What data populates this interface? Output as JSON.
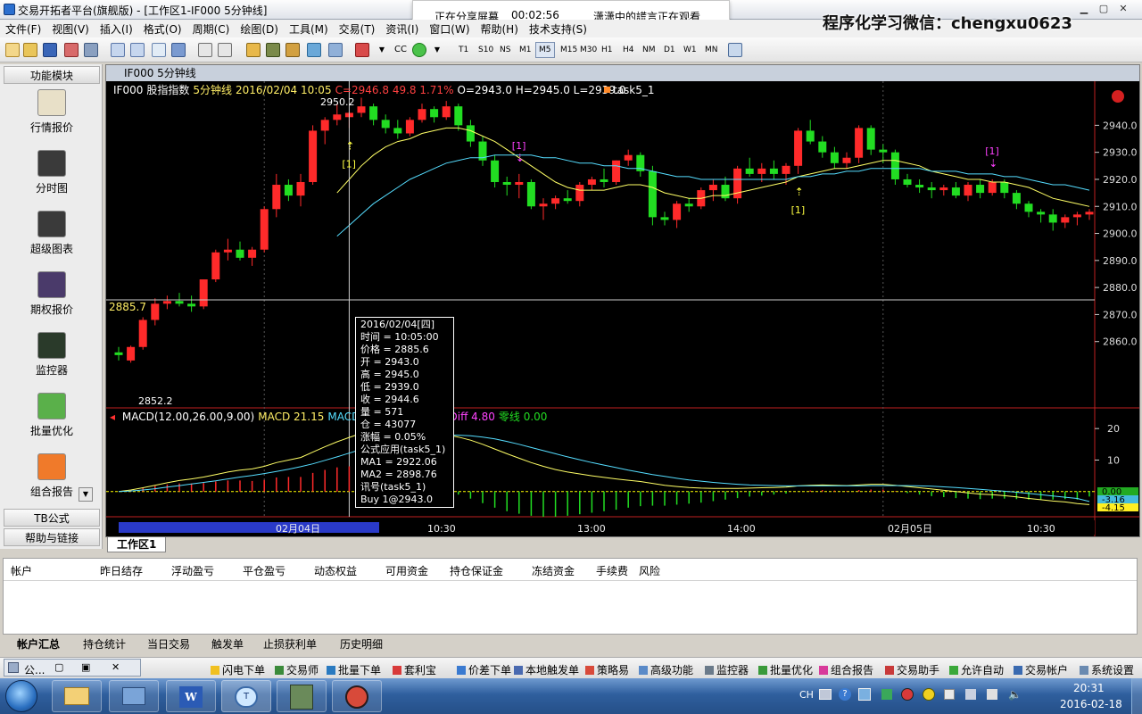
{
  "window": {
    "title": "交易开拓者平台(旗舰版) - [工作区1-IF000 5分钟线]",
    "share_banner": {
      "status": "正在分享屏幕",
      "timer": "00:02:56",
      "viewers": "潇潇中的謊言正在观看"
    },
    "watermark": "程序化学习微信：chengxu0623"
  },
  "menu": [
    "文件(F)",
    "视图(V)",
    "插入(I)",
    "格式(O)",
    "周期(C)",
    "绘图(D)",
    "工具(M)",
    "交易(T)",
    "资讯(I)",
    "窗口(W)",
    "帮助(H)",
    "技术支持(S)"
  ],
  "toolbar": {
    "cc_label": "CC",
    "timeframes": [
      "T1",
      "S10",
      "NS",
      "M1",
      "M5",
      "M15",
      "M30",
      "H1",
      "H4",
      "NM",
      "D1",
      "W1",
      "MN"
    ],
    "selected_timeframe": "M5"
  },
  "sidebar": {
    "header": "功能模块",
    "items": [
      {
        "label": "行情报价",
        "icon": "quote-icon"
      },
      {
        "label": "分时图",
        "icon": "timeshare-icon"
      },
      {
        "label": "超级图表",
        "icon": "super-chart-icon"
      },
      {
        "label": "期权报价",
        "icon": "option-icon"
      },
      {
        "label": "监控器",
        "icon": "monitor-icon"
      },
      {
        "label": "批量优化",
        "icon": "batch-optimize-icon"
      },
      {
        "label": "组合报告",
        "icon": "portfolio-report-icon"
      }
    ],
    "footer1": "TB公式",
    "footer2": "帮助与链接"
  },
  "chart": {
    "window_title": "IF000 5分钟线",
    "header_symbol": "IF000",
    "header_name": "股指指数",
    "header_period": "5分钟线",
    "header_datetime": "2016/02/04 10:05",
    "header_change": "C=2946.8 49.8 1.71%",
    "header_ohlc": "O=2943.0 H=2945.0 L=2939.0",
    "header_task": "task5_1",
    "high_label": "2950.2",
    "low_label": "2852.2",
    "crosshair_price": "2885.7",
    "signal_label": "[1]",
    "macd_header": {
      "name": "MACD(12.00,26.00,9.00)",
      "macd": "MACD 21.15",
      "avg": "MACDAvg 16.35",
      "diff": "MACDDiff 4.80",
      "zero": "零线 0.00"
    },
    "macd_right_labels": [
      "0.00",
      "-3.16",
      "-4.15"
    ],
    "colors": {
      "up": "#ff2a2a",
      "down": "#22dd22",
      "ma1": "#ffff66",
      "ma2": "#55ddff",
      "zero": "#ffff00",
      "diff": "#ff44ff"
    }
  },
  "chart_data": {
    "type": "candlestick",
    "timeframe": "5分钟",
    "price_axis": {
      "ticks": [
        2860.0,
        2870.0,
        2880.0,
        2890.0,
        2900.0,
        2910.0,
        2920.0,
        2930.0,
        2940.0
      ],
      "range": [
        2850,
        2953
      ]
    },
    "macd_axis": {
      "ticks": [
        10,
        20
      ],
      "range": [
        -8,
        26
      ]
    },
    "time_axis_labels": [
      "02月04日",
      "10:30",
      "13:00",
      "14:00",
      "02月05日",
      "10:30"
    ],
    "candles_ohlc": [
      [
        2856.0,
        2858.0,
        2853.0,
        2855.0
      ],
      [
        2853.0,
        2858.5,
        2852.2,
        2858.0
      ],
      [
        2858.0,
        2869.0,
        2857.0,
        2868.0
      ],
      [
        2868.0,
        2876.0,
        2866.0,
        2874.0
      ],
      [
        2874.0,
        2877.0,
        2872.0,
        2875.0
      ],
      [
        2875.0,
        2878.0,
        2873.0,
        2874.0
      ],
      [
        2874.0,
        2877.0,
        2871.0,
        2873.0
      ],
      [
        2873.0,
        2883.0,
        2872.0,
        2883.0
      ],
      [
        2883.0,
        2894.0,
        2882.0,
        2893.0
      ],
      [
        2893.0,
        2898.0,
        2890.0,
        2894.0
      ],
      [
        2894.0,
        2897.0,
        2890.0,
        2891.0
      ],
      [
        2891.0,
        2895.0,
        2888.0,
        2894.0
      ],
      [
        2894.0,
        2910.0,
        2893.0,
        2909.0
      ],
      [
        2909.0,
        2922.0,
        2906.0,
        2918.0
      ],
      [
        2918.0,
        2920.0,
        2912.0,
        2914.0
      ],
      [
        2914.0,
        2922.0,
        2910.0,
        2919.0
      ],
      [
        2919.0,
        2940.0,
        2918.0,
        2938.0
      ],
      [
        2938.0,
        2943.0,
        2933.0,
        2942.0
      ],
      [
        2942.0,
        2948.0,
        2940.0,
        2944.0
      ],
      [
        2943.0,
        2945.0,
        2939.0,
        2944.6
      ],
      [
        2944.6,
        2950.2,
        2943.0,
        2947.0
      ],
      [
        2947.0,
        2948.0,
        2940.0,
        2942.0
      ],
      [
        2942.0,
        2944.0,
        2937.0,
        2939.0
      ],
      [
        2939.0,
        2942.0,
        2935.0,
        2937.0
      ],
      [
        2937.0,
        2943.0,
        2936.0,
        2942.0
      ],
      [
        2942.0,
        2948.0,
        2941.0,
        2946.0
      ],
      [
        2946.0,
        2947.0,
        2941.0,
        2943.0
      ],
      [
        2943.0,
        2949.0,
        2942.0,
        2947.0
      ],
      [
        2947.0,
        2948.0,
        2938.0,
        2940.0
      ],
      [
        2940.0,
        2942.0,
        2932.0,
        2934.0
      ],
      [
        2934.0,
        2936.0,
        2925.0,
        2927.0
      ],
      [
        2927.0,
        2929.0,
        2917.0,
        2919.0
      ],
      [
        2919.0,
        2921.0,
        2914.0,
        2918.0
      ],
      [
        2918.0,
        2922.0,
        2913.0,
        2919.0
      ],
      [
        2919.0,
        2920.0,
        2909.0,
        2910.0
      ],
      [
        2910.0,
        2913.0,
        2905.0,
        2911.0
      ],
      [
        2911.0,
        2914.0,
        2909.0,
        2913.0
      ],
      [
        2913.0,
        2916.0,
        2911.0,
        2912.0
      ],
      [
        2912.0,
        2919.0,
        2910.0,
        2918.0
      ],
      [
        2918.0,
        2921.0,
        2916.0,
        2920.0
      ],
      [
        2920.0,
        2924.0,
        2917.0,
        2919.0
      ],
      [
        2919.0,
        2927.0,
        2918.0,
        2927.0
      ],
      [
        2927.0,
        2931.0,
        2925.0,
        2929.0
      ],
      [
        2929.0,
        2930.0,
        2921.0,
        2923.0
      ],
      [
        2923.0,
        2925.0,
        2903.0,
        2906.0
      ],
      [
        2906.0,
        2908.0,
        2903.0,
        2905.0
      ],
      [
        2905.0,
        2912.0,
        2902.0,
        2911.0
      ],
      [
        2911.0,
        2913.0,
        2908.0,
        2910.0
      ],
      [
        2910.0,
        2917.0,
        2909.0,
        2916.0
      ],
      [
        2916.0,
        2920.0,
        2912.0,
        2918.0
      ],
      [
        2918.0,
        2921.0,
        2912.0,
        2913.0
      ],
      [
        2913.0,
        2925.0,
        2911.0,
        2924.0
      ],
      [
        2924.0,
        2928.0,
        2921.0,
        2922.0
      ],
      [
        2922.0,
        2926.0,
        2919.0,
        2924.0
      ],
      [
        2924.0,
        2927.0,
        2920.0,
        2922.0
      ],
      [
        2922.0,
        2926.0,
        2918.0,
        2925.0
      ],
      [
        2925.0,
        2939.0,
        2922.0,
        2938.0
      ],
      [
        2938.0,
        2942.0,
        2933.0,
        2934.0
      ],
      [
        2934.0,
        2936.0,
        2928.0,
        2930.0
      ],
      [
        2930.0,
        2932.0,
        2924.0,
        2926.0
      ],
      [
        2926.0,
        2930.0,
        2924.0,
        2928.0
      ],
      [
        2928.0,
        2940.0,
        2926.0,
        2939.0
      ],
      [
        2939.0,
        2940.0,
        2929.0,
        2931.0
      ],
      [
        2931.0,
        2933.0,
        2926.0,
        2930.0
      ],
      [
        2930.0,
        2931.0,
        2918.0,
        2920.0
      ],
      [
        2920.0,
        2922.0,
        2917.0,
        2918.0
      ],
      [
        2918.0,
        2920.0,
        2915.0,
        2917.0
      ],
      [
        2917.0,
        2919.0,
        2913.0,
        2916.0
      ],
      [
        2916.0,
        2918.0,
        2914.0,
        2917.0
      ],
      [
        2917.0,
        2919.0,
        2913.0,
        2914.0
      ],
      [
        2914.0,
        2919.0,
        2912.0,
        2918.0
      ],
      [
        2918.0,
        2920.0,
        2913.0,
        2915.0
      ],
      [
        2915.0,
        2920.0,
        2914.0,
        2919.0
      ],
      [
        2919.0,
        2920.0,
        2913.0,
        2915.0
      ],
      [
        2915.0,
        2916.0,
        2909.0,
        2911.0
      ],
      [
        2911.0,
        2912.0,
        2906.0,
        2908.0
      ],
      [
        2908.0,
        2909.0,
        2904.0,
        2907.0
      ],
      [
        2907.0,
        2909.0,
        2901.0,
        2904.0
      ],
      [
        2904.0,
        2907.0,
        2902.0,
        2906.0
      ],
      [
        2906.0,
        2908.0,
        2903.0,
        2907.0
      ],
      [
        2907.0,
        2909.0,
        2905.0,
        2908.0
      ]
    ],
    "ma1": [
      null,
      null,
      null,
      null,
      null,
      null,
      null,
      null,
      null,
      null,
      null,
      null,
      null,
      null,
      null,
      null,
      null,
      null,
      2915,
      2920,
      2925,
      2929,
      2932,
      2934,
      2935,
      2937,
      2938,
      2939,
      2939,
      2938,
      2936,
      2934,
      2931,
      2928,
      2925,
      2922,
      2919,
      2917,
      2916,
      2916,
      2916,
      2917,
      2918,
      2918,
      2917,
      2915,
      2914,
      2913,
      2913,
      2914,
      2914,
      2915,
      2916,
      2917,
      2918,
      2919,
      2921,
      2922,
      2923,
      2924,
      2924,
      2925,
      2926,
      2927,
      2927,
      2926,
      2925,
      2923,
      2922,
      2921,
      2920,
      2920,
      2919,
      2919,
      2918,
      2917,
      2915,
      2913,
      2912,
      2911,
      2910
    ],
    "ma2": [
      null,
      null,
      null,
      null,
      null,
      null,
      null,
      null,
      null,
      null,
      null,
      null,
      null,
      null,
      null,
      null,
      null,
      null,
      2899,
      2903,
      2907,
      2911,
      2914,
      2917,
      2920,
      2922,
      2924,
      2926,
      2927,
      2928,
      2928,
      2929,
      2929,
      2929,
      2929,
      2928,
      2928,
      2927,
      2926,
      2926,
      2925,
      2925,
      2924,
      2924,
      2923,
      2922,
      2921,
      2921,
      2920,
      2920,
      2920,
      2920,
      2920,
      2920,
      2920,
      2920,
      2921,
      2921,
      2922,
      2922,
      2923,
      2923,
      2924,
      2924,
      2924,
      2924,
      2924,
      2923,
      2923,
      2923,
      2922,
      2922,
      2922,
      2921,
      2921,
      2920,
      2919,
      2918,
      2918,
      2917,
      2916
    ],
    "macd_line": [
      0,
      0.5,
      1.2,
      2,
      2.8,
      3.5,
      4,
      4.6,
      5.4,
      6.2,
      6.8,
      7.2,
      8,
      9.2,
      10,
      10.8,
      12.5,
      14.2,
      15.8,
      17.2,
      18.5,
      19.4,
      19.6,
      19.5,
      19.2,
      19,
      18.5,
      18,
      17.3,
      16.3,
      15,
      13.5,
      12,
      10.6,
      9.2,
      8,
      7,
      6.2,
      5.6,
      5,
      4.5,
      4,
      3.6,
      3.2,
      2.6,
      2,
      1.6,
      1.3,
      1.1,
      1,
      1,
      1,
      1.1,
      1.2,
      1.3,
      1.4,
      1.8,
      2,
      2.1,
      2,
      1.9,
      2.1,
      2.3,
      2.3,
      2,
      1.6,
      1.2,
      0.8,
      0.4,
      0,
      -0.4,
      -0.8,
      -1,
      -1.3,
      -1.7,
      -2.2,
      -2.6,
      -3,
      -3.3,
      -3.8,
      -4.15
    ],
    "macd_avg": [
      0,
      0.2,
      0.5,
      0.9,
      1.4,
      1.9,
      2.4,
      2.9,
      3.4,
      4,
      4.6,
      5.1,
      5.7,
      6.4,
      7.1,
      7.9,
      8.8,
      9.9,
      11,
      12.2,
      13.4,
      14.5,
      15.5,
      16.3,
      16.9,
      17.4,
      17.7,
      17.9,
      17.9,
      17.7,
      17.3,
      16.7,
      15.9,
      15,
      14,
      13,
      12,
      11,
      10.1,
      9.2,
      8.4,
      7.6,
      6.8,
      6.1,
      5.4,
      4.8,
      4.2,
      3.7,
      3.3,
      2.9,
      2.6,
      2.3,
      2.1,
      2,
      1.9,
      1.8,
      1.8,
      1.8,
      1.8,
      1.8,
      1.8,
      1.8,
      1.9,
      1.9,
      1.9,
      1.9,
      1.8,
      1.7,
      1.5,
      1.3,
      1,
      0.7,
      0.4,
      0.1,
      -0.2,
      -0.6,
      -1,
      -1.4,
      -1.8,
      -2.2,
      -3.16
    ],
    "signals": [
      {
        "type": "buy",
        "label": "[1]",
        "price": 2943.0,
        "bar": 19
      },
      {
        "type": "sell",
        "label": "[1]",
        "bar": 33
      },
      {
        "type": "buy",
        "label": "[1]",
        "bar": 56
      },
      {
        "type": "sell",
        "label": "[1]",
        "bar": 72
      }
    ]
  },
  "tooltip": [
    "2016/02/04[四]",
    "时间 = 10:05:00",
    "价格 = 2885.6",
    "开 = 2943.0",
    "高 = 2945.0",
    "低 = 2939.0",
    "收 = 2944.6",
    "量 = 571",
    "仓 = 43077",
    "涨幅 = 0.05%",
    "公式应用(task5_1)",
    " MA1 = 2922.06",
    " MA2 = 2898.76",
    "讯号(task5_1)",
    " Buy 1@2943.0"
  ],
  "workspace_tab": "工作区1",
  "account_columns": [
    "帐户",
    "昨日结存",
    "浮动盈亏",
    "平仓盈亏",
    "动态权益",
    "可用资金",
    "持仓保证金",
    "冻结资金",
    "手续费",
    "风险"
  ],
  "account_tabs": [
    "帐户汇总",
    "持仓统计",
    "当日交易",
    "触发单",
    "止损获利单",
    "历史明细"
  ],
  "bottom_left_label": "公...",
  "bottom_tools": [
    "闪电下单",
    "交易师",
    "批量下单",
    "套利宝",
    "价差下单",
    "本地触发单",
    "策略易",
    "高级功能",
    "监控器",
    "批量优化",
    "组合报告",
    "交易助手",
    "允许自动",
    "交易帐户",
    "系统设置"
  ],
  "taskbar": {
    "lang": "CH",
    "time": "20:31",
    "date": "2016-02-18"
  }
}
